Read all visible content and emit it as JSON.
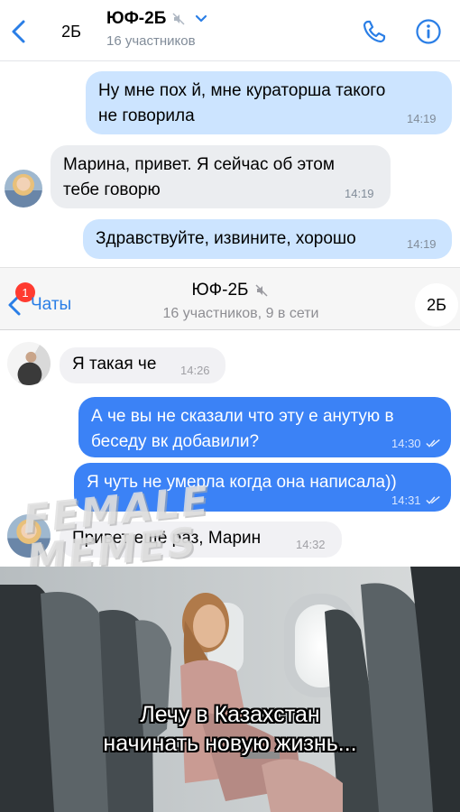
{
  "vk": {
    "header": {
      "avatar_label": "2Б",
      "title": "ЮФ-2Б",
      "subtitle": "16 участников"
    },
    "messages": [
      {
        "text_line1": "Ну мне пох   й, мне кураторша такого",
        "text_line2": "не говорила",
        "time": "14:19"
      },
      {
        "text_line1": "Марина, привет. Я сейчас об этом",
        "text_line2": "тебе говорю",
        "time": "14:19"
      },
      {
        "text": "Здравствуйте, извините, хорошо",
        "time": "14:19"
      }
    ]
  },
  "tg": {
    "header": {
      "badge": "1",
      "back_label": "Чаты",
      "title": "ЮФ-2Б",
      "subtitle": "16 участников, 9 в сети",
      "avatar_label": "2Б"
    },
    "messages": [
      {
        "text": "Я такая че",
        "time": "14:26"
      },
      {
        "text_line1": "А че вы не сказали что эту е   анутую в",
        "text_line2": "беседу вк добавили?",
        "time": "14:30"
      },
      {
        "text": "Я чуть не умерла когда она написала))",
        "time": "14:31"
      },
      {
        "text": "Привет ещё раз, Марин",
        "time": "14:32"
      }
    ]
  },
  "watermark": {
    "line1": "FEMALE",
    "line2": "MEMES"
  },
  "caption": {
    "line1": "Лечу в Казахстан",
    "line2": "начинать новую жизнь..."
  },
  "colors": {
    "vk_accent": "#2a7ee6",
    "vk_out_bubble": "#cce4ff",
    "vk_in_bubble": "#ebedf0",
    "tg_out_bubble": "#3b82f6",
    "tg_in_bubble": "#f1f1f4"
  }
}
